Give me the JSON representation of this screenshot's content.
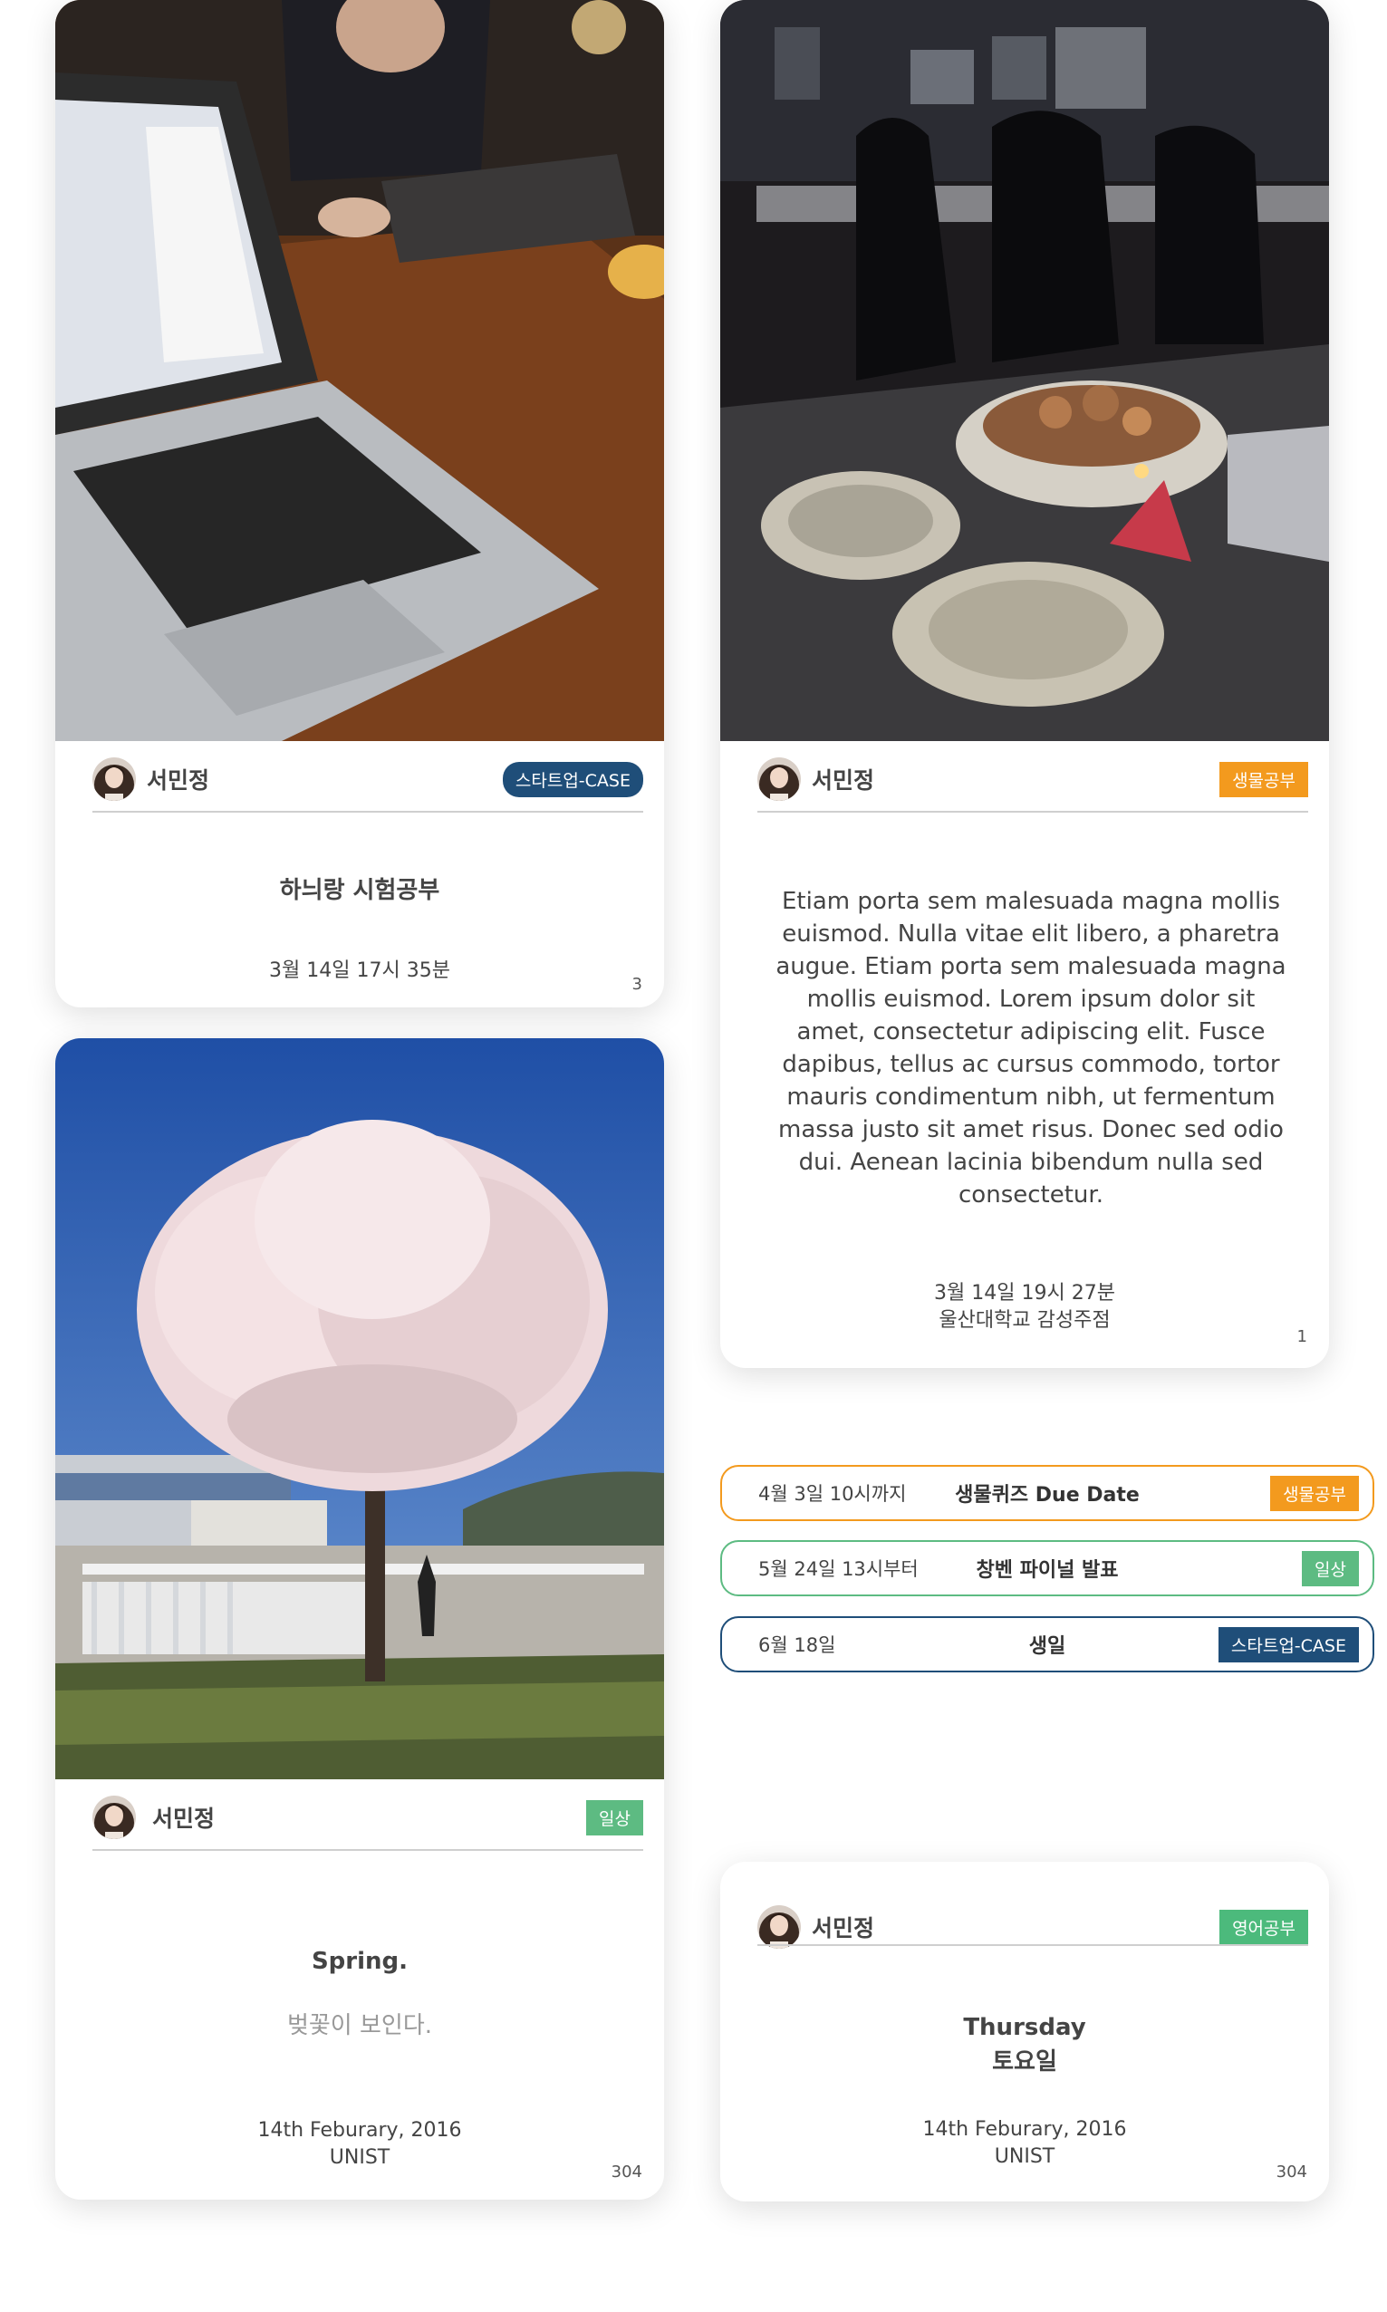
{
  "colors": {
    "startup": "#1f4e79",
    "biology": "#f39a1e",
    "daily": "#5dbb82",
    "english": "#4cba7c"
  },
  "card1": {
    "photo_alt": "laptop-on-table-photo",
    "author": "서민정",
    "tag": "스타트업-CASE",
    "title": "하늬랑 시험공부",
    "meta_line1": "3월 14일 17시 35분",
    "count": "3"
  },
  "card2": {
    "photo_alt": "dark-cafe-candle-photo",
    "author": "서민정",
    "tag": "생물공부",
    "body": "Etiam porta sem malesuada magna mollis euismod. Nulla vitae elit libero, a pharetra augue. Etiam porta sem malesuada magna mollis euismod. Lorem ipsum dolor sit amet, consectetur adipiscing elit. Fusce dapibus, tellus ac cursus commodo, tortor mauris condimentum nibh, ut fermentum massa justo sit amet risus. Donec sed odio dui. Aenean lacinia bibendum nulla sed consectetur.",
    "meta_line1": "3월 14일 19시 27분",
    "meta_line2": "울산대학교 감성주점",
    "count": "1"
  },
  "card3": {
    "photo_alt": "cherry-blossom-tree-photo",
    "author": "서민정",
    "tag": "일상",
    "title": "Spring.",
    "subtitle": "벚꽃이 보인다.",
    "meta_line1": "14th Feburary, 2016",
    "meta_line2": "UNIST",
    "count": "304"
  },
  "card4": {
    "author": "서민정",
    "tag": "영어공부",
    "title_line1": "Thursday",
    "title_line2": "토요일",
    "meta_line1": "14th Feburary, 2016",
    "meta_line2": "UNIST",
    "count": "304"
  },
  "events": [
    {
      "date": "4월 3일 10시까지",
      "title": "생물퀴즈 Due Date",
      "tag": "생물공부"
    },
    {
      "date": "5월 24일 13시부터",
      "title": "창벤 파이널 발표",
      "tag": "일상"
    },
    {
      "date": "6월 18일",
      "title": "생일",
      "tag": "스타트업-CASE"
    }
  ]
}
